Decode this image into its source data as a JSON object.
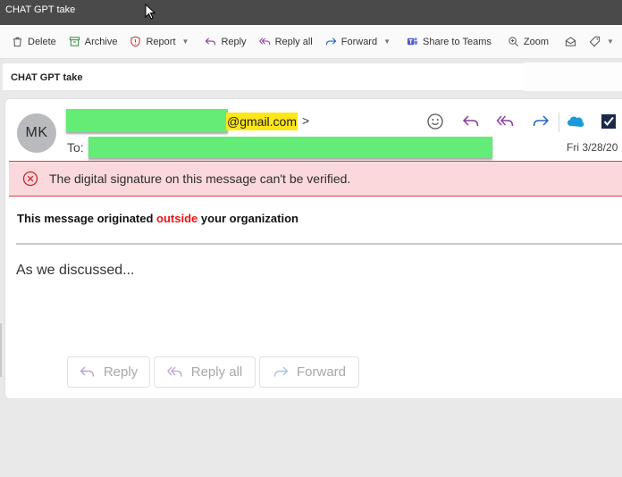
{
  "window": {
    "title": "CHAT GPT take"
  },
  "toolbar": {
    "delete": "Delete",
    "archive": "Archive",
    "report": "Report",
    "reply": "Reply",
    "reply_all": "Reply all",
    "forward": "Forward",
    "share_teams": "Share to Teams",
    "zoom": "Zoom"
  },
  "subject": "CHAT GPT take",
  "message": {
    "avatar_initials": "MK",
    "from_domain": "@gmail.com",
    "from_suffix": ">",
    "to_label": "To:",
    "date": "Fri 3/28/20",
    "signature_warning": "The digital signature on this message can't be verified.",
    "external_prefix": "This message originated ",
    "external_word": "outside",
    "external_suffix": " your organization",
    "body": "As we discussed..."
  },
  "actions": {
    "reply": "Reply",
    "reply_all": "Reply all",
    "forward": "Forward"
  },
  "colors": {
    "title_bar": "#4a4a4a",
    "redaction": "#63ec76",
    "highlight": "#ffe619",
    "warning_bg": "#fad8db",
    "warning_border": "#d3414f",
    "external_red": "#ee1212",
    "reply_purple": "#8a3a9c",
    "forward_blue": "#2266c4"
  }
}
